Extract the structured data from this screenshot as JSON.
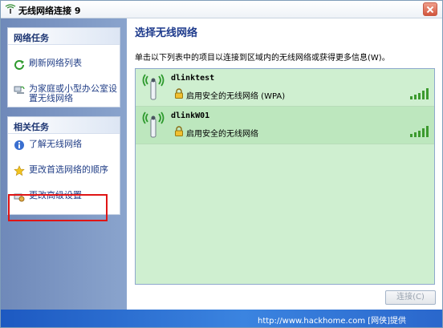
{
  "window": {
    "title": "无线网络连接 9"
  },
  "sidebar": {
    "network_tasks": {
      "header": "网络任务",
      "items": [
        {
          "label": "刷新网络列表",
          "icon": "refresh-icon"
        },
        {
          "label": "为家庭或小型办公室设置无线网络",
          "icon": "network-setup-icon"
        }
      ]
    },
    "related_tasks": {
      "header": "相关任务",
      "items": [
        {
          "label": "了解无线网络",
          "icon": "info-icon"
        },
        {
          "label": "更改首选网络的顺序",
          "icon": "star-icon"
        },
        {
          "label": "更改高级设置",
          "icon": "advanced-settings-icon"
        }
      ]
    }
  },
  "main": {
    "title": "选择无线网络",
    "description": "单击以下列表中的项目以连接到区域内的无线网络或获得更多信息(W)。",
    "networks": [
      {
        "name": "dlinktest",
        "security": "启用安全的无线网络 (WPA)",
        "signal_bars": 5,
        "selected": false
      },
      {
        "name": "dlinkW01",
        "security": "启用安全的无线网络",
        "signal_bars": 5,
        "selected": true
      }
    ],
    "connect_button": "连接(C)"
  },
  "statusbar": {
    "watermark": "http://www.hackhome.com [网侠]提供"
  },
  "colors": {
    "sidebar_blue": "#7b96c4",
    "panel_header_text": "#1c3572",
    "title_blue": "#1d3a8c",
    "list_green": "#cfefd0",
    "signal_green": "#3c9a2e",
    "highlight_red": "#e01515",
    "status_blue": "#2a67cc"
  }
}
